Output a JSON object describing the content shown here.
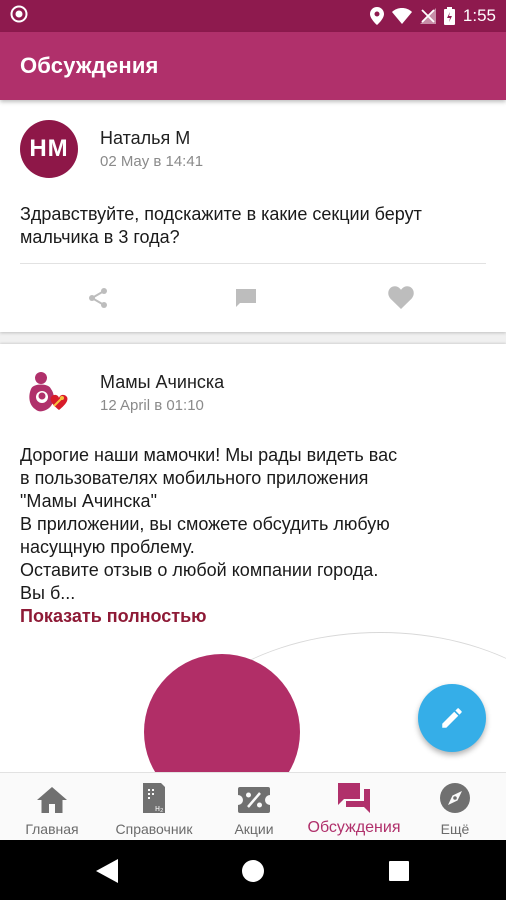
{
  "status_bar": {
    "time": "1:55"
  },
  "app_bar": {
    "title": "Обсуждения"
  },
  "posts": [
    {
      "avatar_initials": "НМ",
      "author": "Наталья М",
      "date": "02 May в 14:41",
      "text_lines": [
        "Здравствуйте, подскажите в какие секции берут",
        "мальчика в 3 года?"
      ],
      "actions": [
        "share-icon",
        "comment-icon",
        "heart-icon"
      ]
    },
    {
      "author": "Мамы Ачинска",
      "date": "12 April в 01:10",
      "text_lines": [
        "Дорогие наши мамочки! Мы рады видеть вас",
        "в пользователях мобильного приложения",
        "\"Мамы Ачинска\"",
        "В приложении, вы сможете обсудить любую",
        "насущную проблему.",
        "Оставите отзыв о любой компании города.",
        "Вы б..."
      ],
      "show_more": "Показать полностью"
    }
  ],
  "fab": {
    "icon": "pencil-icon"
  },
  "bottom_nav": {
    "items": [
      {
        "label": "Главная",
        "icon": "home-icon"
      },
      {
        "label": "Справочник",
        "icon": "directory-icon"
      },
      {
        "label": "Акции",
        "icon": "discount-icon"
      },
      {
        "label": "Обсуждения",
        "icon": "forum-icon",
        "active": true
      },
      {
        "label": "Ещё",
        "icon": "compass-icon"
      }
    ]
  },
  "colors": {
    "primary": "#b0306b",
    "status": "#8e1a4e",
    "accent": "#35aee8",
    "link": "#8e1a36"
  }
}
